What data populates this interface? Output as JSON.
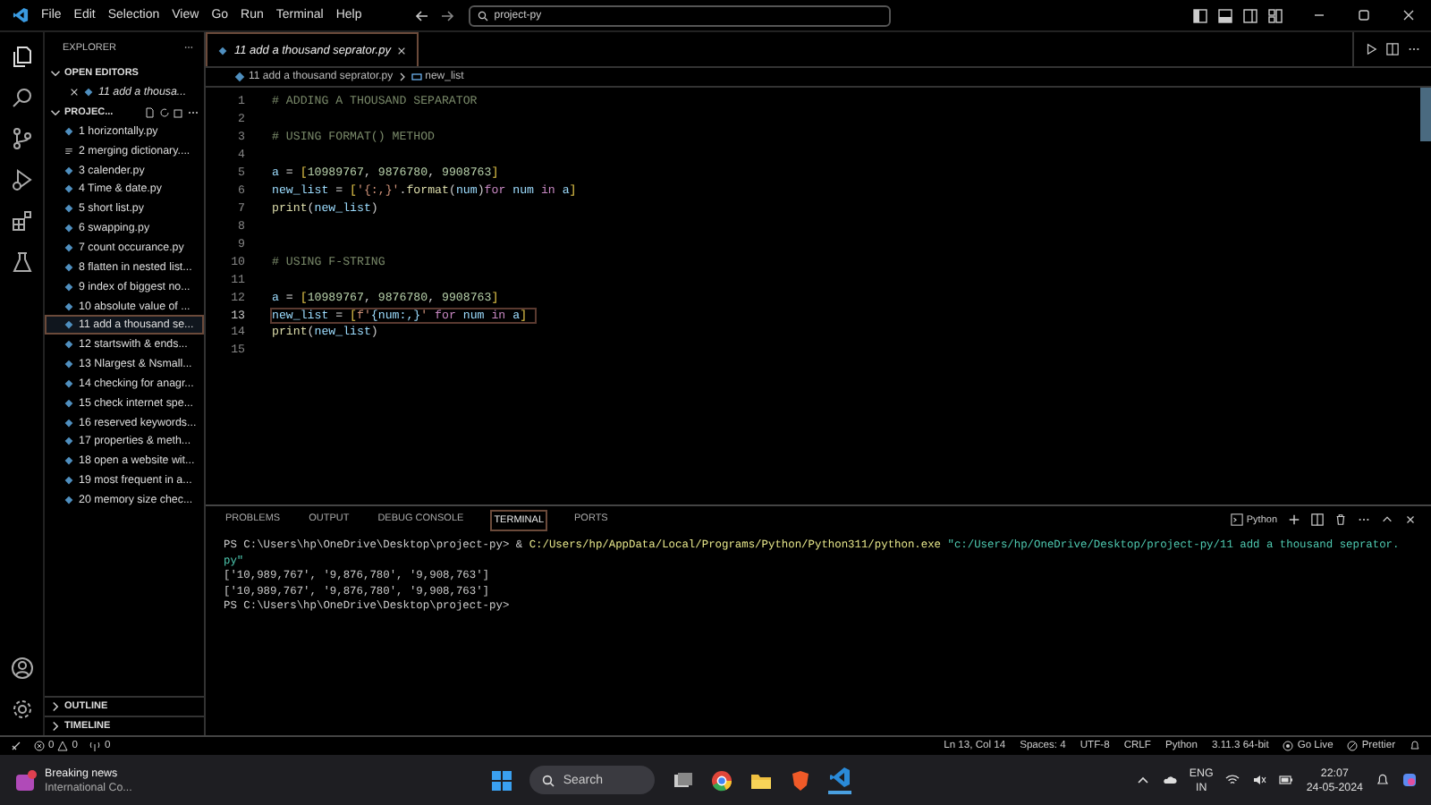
{
  "title_bar": {
    "menu": [
      "File",
      "Edit",
      "Selection",
      "View",
      "Go",
      "Run",
      "Terminal",
      "Help"
    ],
    "search": "project-py"
  },
  "sidebar": {
    "title": "EXPLORER",
    "open_editors": {
      "label": "OPEN EDITORS",
      "expanded": true,
      "items": [
        {
          "name": "11 add a thousa...",
          "selected": false
        }
      ]
    },
    "project": {
      "label": "PROJEC...",
      "expanded": true,
      "files": [
        {
          "name": "1 horizontally.py",
          "kind": "python",
          "selected": false
        },
        {
          "name": "2 merging dictionary....",
          "kind": "text",
          "selected": false
        },
        {
          "name": "3 calender.py",
          "kind": "python",
          "selected": false
        },
        {
          "name": "4  Time & date.py",
          "kind": "python",
          "selected": false
        },
        {
          "name": "5 short list.py",
          "kind": "python",
          "selected": false
        },
        {
          "name": "6 swapping.py",
          "kind": "python",
          "selected": false
        },
        {
          "name": "7 count occurance.py",
          "kind": "python",
          "selected": false
        },
        {
          "name": "8 flatten in nested list...",
          "kind": "python",
          "selected": false
        },
        {
          "name": "9 index of biggest no...",
          "kind": "python",
          "selected": false
        },
        {
          "name": "10 absolute value of ...",
          "kind": "python",
          "selected": false
        },
        {
          "name": "11 add a thousand se...",
          "kind": "python",
          "selected": true
        },
        {
          "name": "12 startswith & ends...",
          "kind": "python",
          "selected": false
        },
        {
          "name": "13 Nlargest & Nsmall...",
          "kind": "python",
          "selected": false
        },
        {
          "name": "14 checking for anagr...",
          "kind": "python",
          "selected": false
        },
        {
          "name": "15 check internet spe...",
          "kind": "python",
          "selected": false
        },
        {
          "name": "16 reserved keywords...",
          "kind": "python",
          "selected": false
        },
        {
          "name": "17 properties & meth...",
          "kind": "python",
          "selected": false
        },
        {
          "name": "18 open a website wit...",
          "kind": "python",
          "selected": false
        },
        {
          "name": "19 most frequent in a...",
          "kind": "python",
          "selected": false
        },
        {
          "name": "20 memory size chec...",
          "kind": "python",
          "selected": false
        }
      ]
    },
    "outline": {
      "label": "OUTLINE",
      "expanded": false
    },
    "timeline": {
      "label": "TIMELINE",
      "expanded": false
    }
  },
  "editor": {
    "tabs": [
      {
        "label": "11 add a thousand seprator.py",
        "selected": true
      }
    ],
    "breadcrumb": {
      "file": "11 add a thousand seprator.py",
      "symbol": "new_list"
    },
    "lines": [
      {
        "number": "1",
        "current": false,
        "tokens": [
          {
            "text": "# ADDING A THOUSAND SEPARATOR",
            "kind": "comment"
          }
        ]
      },
      {
        "number": "2",
        "current": false
      },
      {
        "number": "3",
        "current": false,
        "tokens": [
          {
            "text": "# USING FORMAT() METHOD",
            "kind": "comment"
          }
        ]
      },
      {
        "number": "4",
        "current": false
      },
      {
        "number": "5",
        "current": false,
        "tokens": [
          {
            "text": "a",
            "kind": "var"
          },
          {
            "text": " = ",
            "kind": "plain"
          },
          {
            "text": "[",
            "kind": "bracket"
          },
          {
            "text": "10989767",
            "kind": "number"
          },
          {
            "text": ", ",
            "kind": "plain"
          },
          {
            "text": "9876780",
            "kind": "number"
          },
          {
            "text": ", ",
            "kind": "plain"
          },
          {
            "text": "9908763",
            "kind": "number"
          },
          {
            "text": "]",
            "kind": "bracket"
          }
        ]
      },
      {
        "number": "6",
        "current": false,
        "tokens": [
          {
            "text": "new_list",
            "kind": "var"
          },
          {
            "text": " = ",
            "kind": "plain"
          },
          {
            "text": "[",
            "kind": "bracket"
          },
          {
            "text": "'{:,}'",
            "kind": "string"
          },
          {
            "text": ".",
            "kind": "plain"
          },
          {
            "text": "format",
            "kind": "func"
          },
          {
            "text": "(",
            "kind": "plain"
          },
          {
            "text": "num",
            "kind": "var"
          },
          {
            "text": ")",
            "kind": "plain"
          },
          {
            "text": "for",
            "kind": "keyword"
          },
          {
            "text": " num ",
            "kind": "var"
          },
          {
            "text": "in",
            "kind": "keyword"
          },
          {
            "text": " a",
            "kind": "var"
          },
          {
            "text": "]",
            "kind": "bracket"
          }
        ]
      },
      {
        "number": "7",
        "current": false,
        "tokens": [
          {
            "text": "print",
            "kind": "func"
          },
          {
            "text": "(",
            "kind": "plain"
          },
          {
            "text": "new_list",
            "kind": "var"
          },
          {
            "text": ")",
            "kind": "plain"
          }
        ]
      },
      {
        "number": "8",
        "current": false
      },
      {
        "number": "9",
        "current": false
      },
      {
        "number": "10",
        "current": false,
        "tokens": [
          {
            "text": "# USING F-STRING",
            "kind": "comment"
          }
        ]
      },
      {
        "number": "11",
        "current": false
      },
      {
        "number": "12",
        "current": false,
        "tokens": [
          {
            "text": "a",
            "kind": "var"
          },
          {
            "text": " = ",
            "kind": "plain"
          },
          {
            "text": "[",
            "kind": "bracket"
          },
          {
            "text": "10989767",
            "kind": "number"
          },
          {
            "text": ", ",
            "kind": "plain"
          },
          {
            "text": "9876780",
            "kind": "number"
          },
          {
            "text": ", ",
            "kind": "plain"
          },
          {
            "text": "9908763",
            "kind": "number"
          },
          {
            "text": "]",
            "kind": "bracket"
          }
        ]
      },
      {
        "number": "13",
        "current": true,
        "tokens": [
          {
            "text": "new_list",
            "kind": "var"
          },
          {
            "text": " = ",
            "kind": "plain"
          },
          {
            "text": "[",
            "kind": "bracket"
          },
          {
            "text": "f'",
            "kind": "string"
          },
          {
            "text": "{num:,}",
            "kind": "var"
          },
          {
            "text": "'",
            "kind": "string"
          },
          {
            "text": " for ",
            "kind": "keyword"
          },
          {
            "text": "num ",
            "kind": "var"
          },
          {
            "text": "in",
            "kind": "keyword"
          },
          {
            "text": " a",
            "kind": "var"
          },
          {
            "text": "]",
            "kind": "bracket"
          }
        ]
      },
      {
        "number": "14",
        "current": false,
        "tokens": [
          {
            "text": "print",
            "kind": "func"
          },
          {
            "text": "(",
            "kind": "plain"
          },
          {
            "text": "new_list",
            "kind": "var"
          },
          {
            "text": ")",
            "kind": "plain"
          }
        ]
      },
      {
        "number": "15",
        "current": false
      }
    ]
  },
  "panel": {
    "tabs": [
      {
        "label": "PROBLEMS",
        "selected": false
      },
      {
        "label": "OUTPUT",
        "selected": false
      },
      {
        "label": "DEBUG CONSOLE",
        "selected": false
      },
      {
        "label": "TERMINAL",
        "selected": true
      },
      {
        "label": "PORTS",
        "selected": false
      }
    ],
    "terminal_profile": "Python",
    "lines": [
      [
        {
          "text": "PS C:\\Users\\hp\\OneDrive\\Desktop\\project-py> & ",
          "kind": "plain"
        },
        {
          "text": "C:/Users/hp/AppData/Local/Programs/Python/Python311/python.exe",
          "kind": "path"
        },
        {
          "text": " \"c:/Users/hp/OneDrive/Desktop/project-py/11 add a thousand seprator.",
          "kind": "string"
        }
      ],
      [
        {
          "text": "py\"",
          "kind": "string"
        }
      ],
      [
        {
          "text": "['10,989,767', '9,876,780', '9,908,763']",
          "kind": "plain"
        }
      ],
      [
        {
          "text": "['10,989,767', '9,876,780', '9,908,763']",
          "kind": "plain"
        }
      ],
      [
        {
          "text": "PS C:\\Users\\hp\\OneDrive\\Desktop\\project-py>",
          "kind": "plain"
        }
      ]
    ]
  },
  "status_bar": {
    "errors": "0",
    "warnings": "0",
    "ports": "0",
    "items": [
      "Ln 13, Col 14",
      "Spaces: 4",
      "UTF-8",
      "CRLF",
      "Python",
      "3.11.3 64-bit"
    ],
    "go_live": "Go Live",
    "prettier": "Prettier"
  },
  "taskbar": {
    "news": {
      "title": "Breaking news",
      "subtitle": "International Co..."
    },
    "search": "Search",
    "language": [
      "ENG",
      "IN"
    ],
    "time": "22:07",
    "date": "24-05-2024"
  }
}
